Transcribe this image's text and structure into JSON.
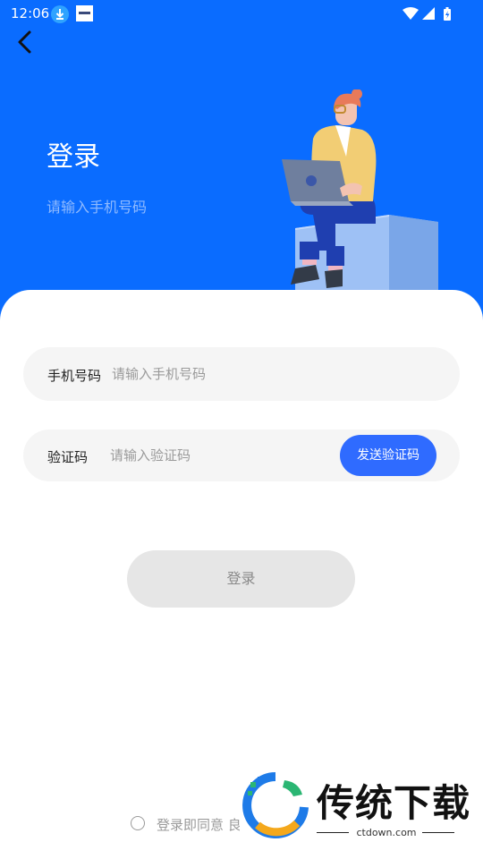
{
  "status_bar": {
    "time": "12:06"
  },
  "header": {
    "title": "登录",
    "subtitle": "请输入手机号码"
  },
  "form": {
    "phone": {
      "label": "手机号码",
      "placeholder": "请输入手机号码"
    },
    "code": {
      "label": "验证码",
      "placeholder": "请输入验证码",
      "send_label": "发送验证码"
    },
    "login_label": "登录"
  },
  "agreement": {
    "text": "登录即同意 良"
  },
  "watermark": {
    "name": "传统下载",
    "url": "ctdown.com"
  },
  "colors": {
    "primary": "#0a6cff",
    "button_blue": "#2f6bff",
    "field_bg": "#f5f5f5",
    "disabled_bg": "#e6e6e6"
  },
  "icons": [
    "download-icon",
    "app-thumbnail-icon",
    "wifi-icon",
    "signal-icon",
    "battery-icon",
    "back-arrow-icon"
  ]
}
